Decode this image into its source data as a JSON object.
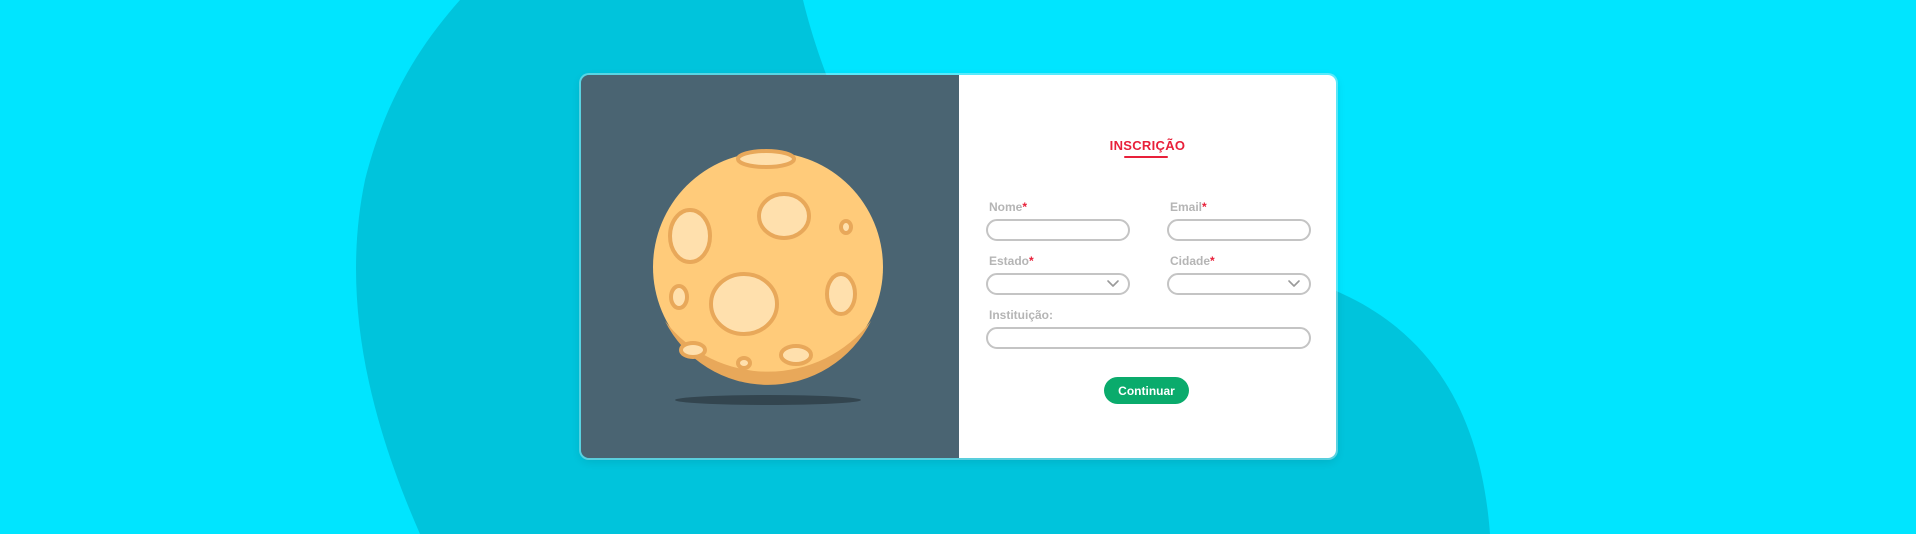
{
  "colors": {
    "background": "#00e5ff",
    "blob": "#00c4dc",
    "left_panel": "#4a6472",
    "moon_body": "#ffcb7a",
    "moon_shade": "#e8a85a",
    "crater_light": "#ffe0ad",
    "moon_shadow": "#33454f",
    "accent_red": "#e8203a",
    "button_green": "#0aab6c"
  },
  "form": {
    "title": "INSCRIÇÃO",
    "required_mark": "*",
    "fields": {
      "nome": {
        "label": "Nome",
        "value": "",
        "required": true
      },
      "email": {
        "label": "Email",
        "value": "",
        "required": true
      },
      "estado": {
        "label": "Estado",
        "value": "",
        "required": true
      },
      "cidade": {
        "label": "Cidade",
        "value": "",
        "required": true
      },
      "instituicao": {
        "label": "Instituição:",
        "value": ""
      }
    },
    "submit_label": "Continuar"
  },
  "illustration": {
    "subject": "moon-illustration",
    "icons": [
      "chevron-down-icon"
    ]
  }
}
